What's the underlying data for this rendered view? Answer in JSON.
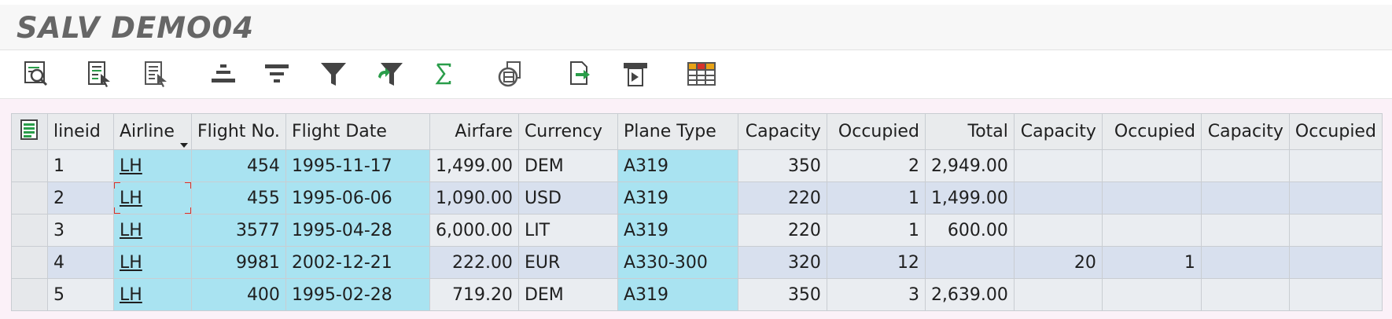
{
  "title": "SALV DEMO04",
  "toolbar": {
    "buttons": [
      {
        "icon": "details-icon"
      },
      {
        "icon": "select-layout-icon"
      },
      {
        "icon": "change-layout-icon"
      },
      {
        "icon": "sort-ascending-icon"
      },
      {
        "icon": "sort-descending-icon"
      },
      {
        "icon": "filter-icon"
      },
      {
        "icon": "delete-filter-icon"
      },
      {
        "icon": "sum-icon"
      },
      {
        "icon": "print-preview-icon"
      },
      {
        "icon": "export-icon"
      },
      {
        "icon": "print-icon"
      },
      {
        "icon": "layout-grid-icon"
      }
    ]
  },
  "table": {
    "columns": [
      "lineid",
      "Airline",
      "Flight No.",
      "Flight Date",
      "Airfare",
      "Currency",
      "Plane Type",
      "Capacity",
      "Occupied",
      "Total",
      "Capacity",
      "Occupied",
      "Capacity",
      "Occupied"
    ],
    "rows": [
      [
        "1",
        "LH",
        "454",
        "1995-11-17",
        "1,499.00",
        "DEM",
        "A319",
        "350",
        "2",
        "2,949.00",
        "",
        "",
        "",
        ""
      ],
      [
        "2",
        "LH",
        "455",
        "1995-06-06",
        "1,090.00",
        "USD",
        "A319",
        "220",
        "1",
        "1,499.00",
        "",
        "",
        "",
        ""
      ],
      [
        "3",
        "LH",
        "3577",
        "1995-04-28",
        "6,000.00",
        "LIT",
        "A319",
        "220",
        "1",
        "600.00",
        "",
        "",
        "",
        ""
      ],
      [
        "4",
        "LH",
        "9981",
        "2002-12-21",
        "222.00",
        "EUR",
        "A330-300",
        "320",
        "12",
        "",
        "20",
        "1",
        "",
        ""
      ],
      [
        "5",
        "LH",
        "400",
        "1995-02-28",
        "719.20",
        "DEM",
        "A319",
        "350",
        "3",
        "2,639.00",
        "",
        "",
        "",
        ""
      ]
    ]
  },
  "colors": {
    "key_column": "#a9e3f1",
    "row_odd": "#eaedf1",
    "row_even": "#d8e0ee",
    "focus_marker": "#d6322b",
    "sum_icon": "#2a9d4a"
  }
}
